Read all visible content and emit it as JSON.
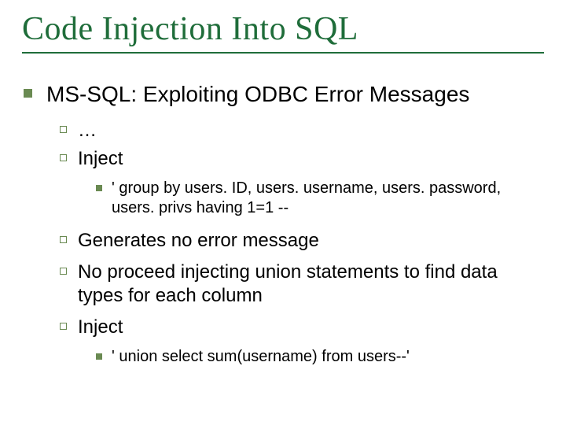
{
  "title": "Code Injection Into SQL",
  "l1": {
    "text": "MS-SQL: Exploiting ODBC Error Messages"
  },
  "l2": [
    {
      "text": "…"
    },
    {
      "text": "Inject"
    },
    {
      "text": "Generates no error message"
    },
    {
      "text": "No proceed injecting union statements to find data types for each column"
    },
    {
      "text": "Inject"
    }
  ],
  "l3": [
    {
      "text": "' group by users. ID, users. username, users. password, users. privs  having 1=1 --"
    },
    {
      "text": "' union select sum(username) from users--'"
    }
  ]
}
